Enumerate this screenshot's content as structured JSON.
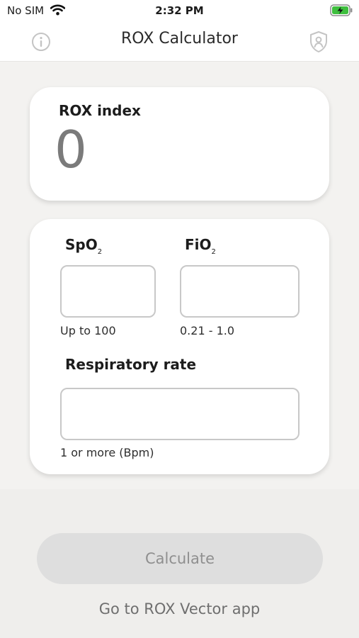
{
  "status": {
    "carrier": "No SIM",
    "time": "2:32 PM",
    "battery_color": "#3ebf3e"
  },
  "header": {
    "title": "ROX Calculator",
    "left_icon": "info-icon",
    "right_icon": "shield-user-icon"
  },
  "result": {
    "label": "ROX index",
    "value": "0"
  },
  "inputs": {
    "spo2": {
      "label": "SpO",
      "label_sub": "2",
      "value": "",
      "hint": "Up to 100"
    },
    "fio2": {
      "label": "FiO",
      "label_sub": "2",
      "value": "",
      "hint": "0.21 - 1.0"
    },
    "respiratory_rate": {
      "label": "Respiratory rate",
      "value": "",
      "hint": "1 or more (Bpm)"
    }
  },
  "actions": {
    "calculate_label": "Calculate",
    "goto_link": "Go to ROX Vector app"
  }
}
